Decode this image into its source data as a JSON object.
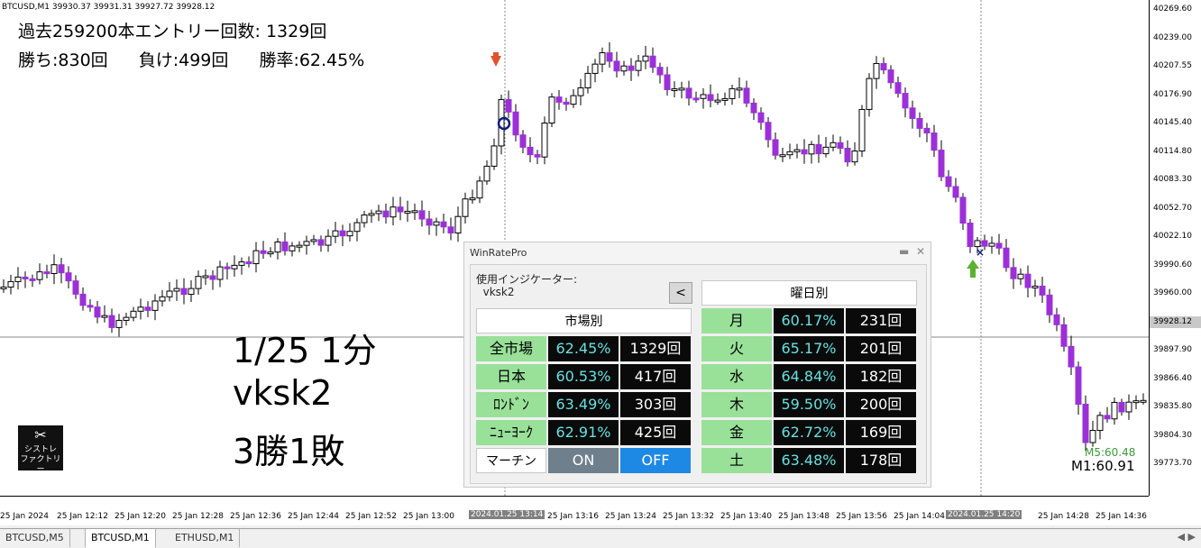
{
  "chart": {
    "symbol_header": "BTCUSD,M1  39930.37 39931.31 39927.72 39928.12",
    "stats_line1": "過去259200本エントリー回数: 1329回",
    "wins": "勝ち:830回",
    "losses": "負け:499回",
    "win_rate": "勝率:62.45%",
    "overlay_lines": [
      "1/25 1分",
      "vksk2",
      "3勝1敗"
    ],
    "logo_line1": "シストレ",
    "logo_line2": "ファクトリー",
    "m5_label": "M5:60.48",
    "m1_label": "M1:60.91",
    "bull_color": "#ffffff",
    "bear_color": "#9b30d9",
    "down_arrow_color": "#e0522a",
    "up_arrow_color": "#5cb032",
    "circle_marker_color": "#0b1e7a",
    "price_axis": [
      "40269.60",
      "40239.00",
      "40207.55",
      "40176.90",
      "40145.40",
      "40114.80",
      "40083.30",
      "40052.70",
      "40022.10",
      "39990.60",
      "39960.00",
      "39928.12",
      "39897.90",
      "39866.40",
      "39835.80",
      "39804.30",
      "39773.70"
    ],
    "current_price": "39928.12",
    "time_axis": [
      "25 Jan 2024",
      "25 Jan 12:12",
      "25 Jan 12:20",
      "25 Jan 12:28",
      "25 Jan 12:36",
      "25 Jan 12:44",
      "25 Jan 12:52",
      "25 Jan 13:00",
      "25 Jan 13:16",
      "25 Jan 13:24",
      "25 Jan 13:32",
      "25 Jan 13:40",
      "25 Jan 13:48",
      "25 Jan 13:56",
      "25 Jan 14:04",
      "25 Jan 14:28",
      "25 Jan 14:36"
    ],
    "time_cross_1": "2024.01.25 13:14",
    "time_cross_2": "2024.01.25 14:20"
  },
  "tabs": [
    "BTCUSD,M5",
    "BTCUSD,M1",
    "ETHUSD,M1"
  ],
  "panel": {
    "title": "WinRatePro",
    "indicator_label": "使用インジケーター:\n  vksk2",
    "collapse_button": "<",
    "market_header": "市場別",
    "weekday_header": "曜日別",
    "markets": [
      {
        "name": "全市場",
        "rate": "62.45%",
        "count": "1329回"
      },
      {
        "name": "日本",
        "rate": "60.53%",
        "count": "417回"
      },
      {
        "name": "ﾛﾝﾄﾞﾝ",
        "rate": "63.49%",
        "count": "303回"
      },
      {
        "name": "ﾆｭｰﾖｰｸ",
        "rate": "62.91%",
        "count": "425回"
      }
    ],
    "weekdays": [
      {
        "name": "月",
        "rate": "60.17%",
        "count": "231回"
      },
      {
        "name": "火",
        "rate": "65.17%",
        "count": "201回"
      },
      {
        "name": "水",
        "rate": "64.84%",
        "count": "182回"
      },
      {
        "name": "木",
        "rate": "59.50%",
        "count": "200回"
      },
      {
        "name": "金",
        "rate": "62.72%",
        "count": "169回"
      },
      {
        "name": "土",
        "rate": "63.48%",
        "count": "178回"
      }
    ],
    "martingale_label": "マーチン",
    "on_label": "ON",
    "off_label": "OFF"
  }
}
